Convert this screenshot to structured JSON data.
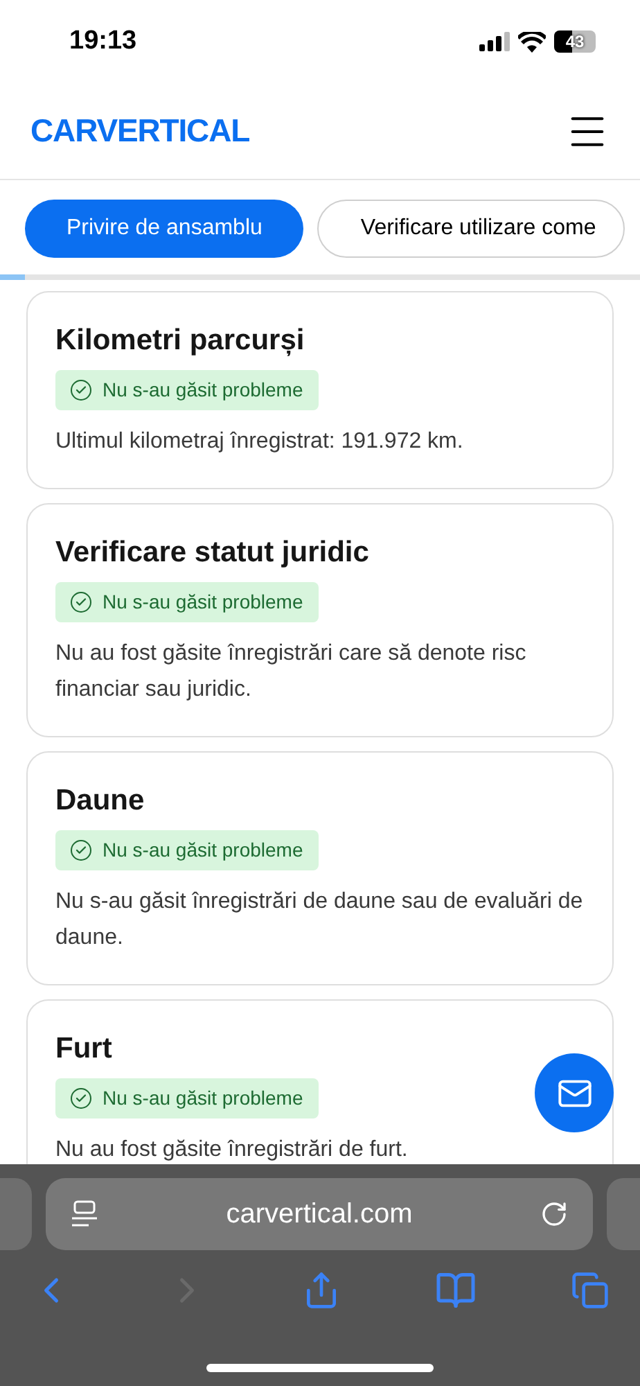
{
  "status_bar": {
    "time": "19:13",
    "battery": "43"
  },
  "header": {
    "logo": "CARVERTICAL"
  },
  "tabs": [
    {
      "label": "Privire de ansamblu",
      "selected": true
    },
    {
      "label": "Verificare utilizare come",
      "selected": false
    }
  ],
  "progress": {
    "level": 0.04
  },
  "cards": [
    {
      "title": "Kilometri parcurși",
      "status": {
        "kind": "ok",
        "text": "Nu s-au găsit probleme"
      },
      "description": "Ultimul kilometraj înregistrat: 191.972 km."
    },
    {
      "title": "Verificare statut juridic",
      "status": {
        "kind": "ok",
        "text": "Nu s-au găsit probleme"
      },
      "description": "Nu au fost găsite înregistrări care să denote risc financiar sau juridic."
    },
    {
      "title": "Daune",
      "status": {
        "kind": "ok",
        "text": "Nu s-au găsit probleme"
      },
      "description": "Nu s-au găsit înregistrări de daune sau de evaluări de daune."
    },
    {
      "title": "Furt",
      "status": {
        "kind": "ok",
        "text": "Nu s-au găsit probleme"
      },
      "description": "Nu au fost găsite înregistrări de furt."
    }
  ],
  "browser": {
    "url": "carvertical.com",
    "back_disabled": false,
    "forward_disabled": true
  }
}
